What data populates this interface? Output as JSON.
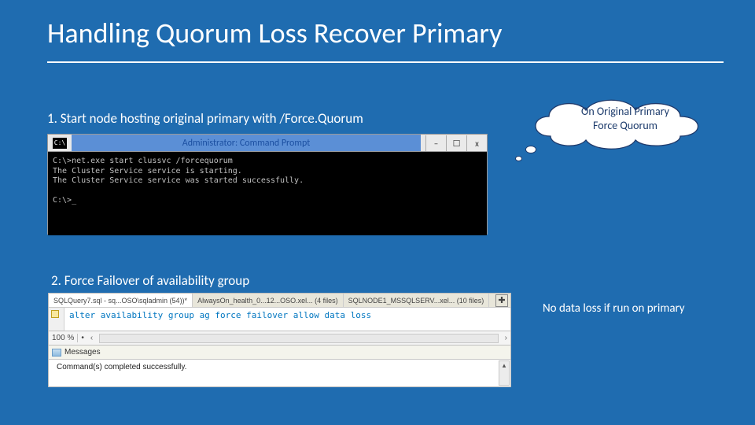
{
  "title": "Handling Quorum Loss Recover Primary",
  "step1": "1. Start node hosting original primary with /Force.Quorum",
  "step2": "2. Force Failover of availability group",
  "note": "No data loss if run on primary",
  "cmd": {
    "window_title": "Administrator: Command Prompt",
    "minimize": "–",
    "maximize": "☐",
    "close": "x",
    "body": "C:\\>net.exe start clussvc /forcequorum\nThe Cluster Service service is starting.\nThe Cluster Service service was started successfully.\n\nC:\\>_"
  },
  "ssms": {
    "tab1": "SQLQuery7.sql - sq...OSO\\sqladmin (54))*",
    "tab2": "AlwaysOn_health_0...12...OSO.xel... (4 files)",
    "tab3": "SQLNODE1_MSSQLSERV...xel... (10 files)",
    "plus": "✚",
    "query": "alter availability group ag force failover allow data loss",
    "zoom": "100 %",
    "zoom_bullet": "•",
    "scroll_left": "‹",
    "scroll_right": "›",
    "messages_tab": "Messages",
    "messages_body": "Command(s) completed successfully.",
    "vscroll_up": "▴"
  },
  "callout": {
    "line1": "On Original Primary",
    "line2": "Force Quorum"
  }
}
